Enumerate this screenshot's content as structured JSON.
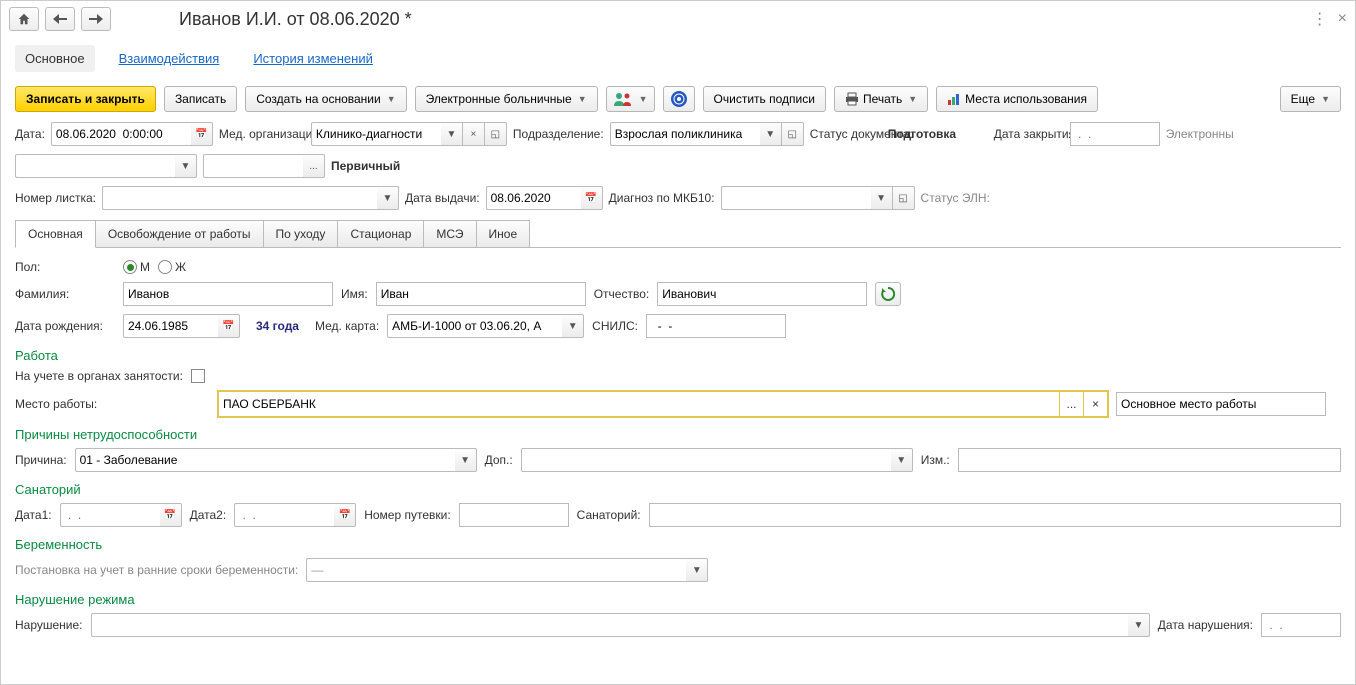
{
  "title": "Иванов И.И. от 08.06.2020 *",
  "topTabs": {
    "main": "Основное",
    "inter": "Взаимодействия",
    "history": "История изменений"
  },
  "toolbar": {
    "saveClose": "Записать и закрыть",
    "save": "Записать",
    "createBased": "Создать на основании",
    "eln": "Электронные больничные",
    "clearSign": "Очистить подписи",
    "print": "Печать",
    "usage": "Места использования",
    "more": "Еще"
  },
  "row1": {
    "dateLabel": "Дата:",
    "dateValue": "08.06.2020  0:00:00",
    "orgLabel": "Мед. организация:",
    "orgValue": "Клинико-диагности",
    "deptLabel": "Подразделение:",
    "deptValue": "Взрослая поликлиника",
    "statusLabel": "Статус документа:",
    "statusValue": "Подготовка",
    "closeDateLabel": "Дата закрытия:",
    "closeDatePlaceholder": " .  .    ",
    "electronic": "Электронны"
  },
  "row2": {
    "primary": "Первичный",
    "ellipsis": "..."
  },
  "row3": {
    "numLabel": "Номер листка:",
    "issueLabel": "Дата выдачи:",
    "issueValue": "08.06.2020",
    "mkbLabel": "Диагноз по МКБ10:",
    "elnStatusLabel": "Статус ЭЛН:"
  },
  "tabs": {
    "t1": "Основная",
    "t2": "Освобождение от работы",
    "t3": "По уходу",
    "t4": "Стационар",
    "t5": "МСЭ",
    "t6": "Иное"
  },
  "gender": {
    "label": "Пол:",
    "m": "М",
    "f": "Ж"
  },
  "name": {
    "famLabel": "Фамилия:",
    "famValue": "Иванов",
    "nameLabel": "Имя:",
    "nameValue": "Иван",
    "patrLabel": "Отчество:",
    "patrValue": "Иванович"
  },
  "birth": {
    "label": "Дата рождения:",
    "value": "24.06.1985",
    "age": "34 года",
    "cardLabel": "Мед. карта:",
    "cardValue": "АМБ-И-1000 от 03.06.20, А",
    "snilsLabel": "СНИЛС:",
    "snilsValue": "  -  -"
  },
  "work": {
    "title": "Работа",
    "regLabel": "На учете в органах занятости:",
    "placeLabel": "Место работы:",
    "placeValue": "ПАО СБЕРБАНК",
    "typeValue": "Основное место работы",
    "ell": "...",
    "x": "×"
  },
  "reason": {
    "title": "Причины нетрудоспособности",
    "label": "Причина:",
    "value": "01 - Заболевание",
    "addLabel": "Доп.:",
    "chgLabel": "Изм.:"
  },
  "san": {
    "title": "Санаторий",
    "d1Label": "Дата1:",
    "d2Label": "Дата2:",
    "ph": " .  .    ",
    "numLabel": "Номер путевки:",
    "sanLabel": "Санаторий:"
  },
  "preg": {
    "title": "Беременность",
    "label": "Постановка на учет в ранние сроки беременности:",
    "dash": "—"
  },
  "viol": {
    "title": "Нарушение режима",
    "label": "Нарушение:",
    "dateLabel": "Дата нарушения:",
    "ph": " .  .  "
  }
}
